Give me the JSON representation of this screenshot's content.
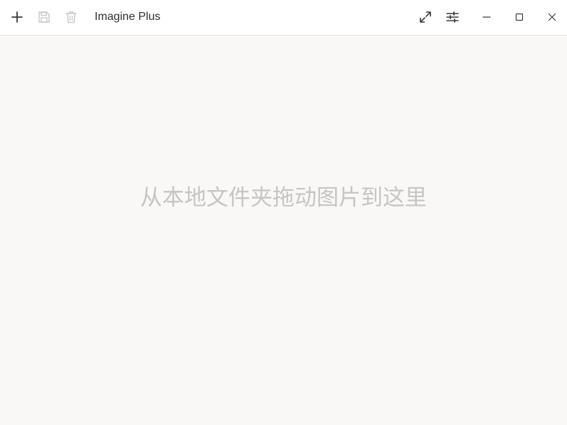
{
  "window": {
    "title": "Imagine Plus"
  },
  "toolbar": {
    "left_icons": [
      "plus-icon",
      "save-icon",
      "trash-icon"
    ],
    "right_icons": [
      "expand-icon",
      "sliders-icon",
      "minimize-icon",
      "maximize-icon",
      "close-icon"
    ]
  },
  "workspace": {
    "drop_hint": "从本地文件夹拖动图片到这里"
  },
  "colors": {
    "titlebar_bg": "#ffffff",
    "workspace_bg": "#f9f8f6",
    "icon_active": "#3a3a3a",
    "icon_disabled": "#c8c8c8",
    "hint_text": "#c7c5c2"
  }
}
